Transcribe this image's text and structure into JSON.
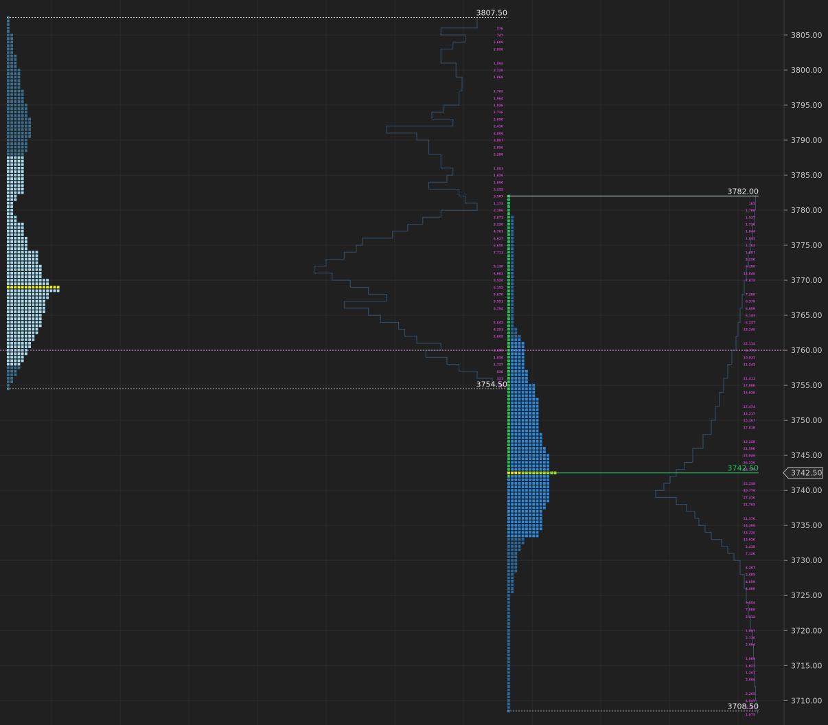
{
  "chart_data": {
    "type": "market-profile",
    "y_axis": {
      "min": 3706.5,
      "max": 3810.0,
      "ticks": [
        "3710.00",
        "3715.00",
        "3720.00",
        "3725.00",
        "3730.00",
        "3735.00",
        "3740.00",
        "3745.00",
        "3750.00",
        "3755.00",
        "3760.00",
        "3765.00",
        "3770.00",
        "3775.00",
        "3780.00",
        "3785.00",
        "3790.00",
        "3795.00",
        "3800.00",
        "3805.00"
      ],
      "tick_step": 5,
      "side": "right",
      "current_price": "3742.50",
      "grid": true
    },
    "profiles": [
      {
        "name": "prior-session",
        "high": 3807.5,
        "low": 3754.5,
        "high_label": "3807.50",
        "low_label": "3754.50",
        "poc": 3769.0,
        "tpo_tick": 0.5,
        "value_area": [
          3758.0,
          3787.5
        ],
        "colors": {
          "outside_va": "#3a6f90",
          "inside_va": "#a8dcf0",
          "poc": "#f2f21a"
        },
        "tpo_counts": [
          [
            3807.5,
            1
          ],
          [
            3805,
            2
          ],
          [
            3802,
            3
          ],
          [
            3800,
            4
          ],
          [
            3797,
            5
          ],
          [
            3795,
            6
          ],
          [
            3793,
            7
          ],
          [
            3790,
            6
          ],
          [
            3788,
            5
          ],
          [
            3786,
            5
          ],
          [
            3784,
            5
          ],
          [
            3782,
            3
          ],
          [
            3781,
            2
          ],
          [
            3780,
            2
          ],
          [
            3779,
            3
          ],
          [
            3778,
            5
          ],
          [
            3776,
            6
          ],
          [
            3774,
            9
          ],
          [
            3772,
            10
          ],
          [
            3770,
            12
          ],
          [
            3769,
            15
          ],
          [
            3768,
            12
          ],
          [
            3767,
            11
          ],
          [
            3765,
            10
          ],
          [
            3763,
            9
          ],
          [
            3762,
            8
          ],
          [
            3761,
            7
          ],
          [
            3760,
            6
          ],
          [
            3759,
            5
          ],
          [
            3758,
            4
          ],
          [
            3757,
            3
          ],
          [
            3756,
            2
          ],
          [
            3755,
            1
          ],
          [
            3754.5,
            1
          ]
        ],
        "volume_outline": [
          [
            3807.5,
            0.1
          ],
          [
            3806,
            0.22
          ],
          [
            3805,
            0.14
          ],
          [
            3804,
            0.18
          ],
          [
            3803,
            0.22
          ],
          [
            3801,
            0.17
          ],
          [
            3799,
            0.15
          ],
          [
            3797,
            0.16
          ],
          [
            3795,
            0.21
          ],
          [
            3794,
            0.25
          ],
          [
            3793,
            0.18
          ],
          [
            3792,
            0.4
          ],
          [
            3791,
            0.3
          ],
          [
            3790,
            0.26
          ],
          [
            3788,
            0.22
          ],
          [
            3786,
            0.18
          ],
          [
            3785,
            0.2
          ],
          [
            3784,
            0.26
          ],
          [
            3783,
            0.16
          ],
          [
            3782,
            0.14
          ],
          [
            3781,
            0.1
          ],
          [
            3780,
            0.22
          ],
          [
            3779,
            0.28
          ],
          [
            3778,
            0.33
          ],
          [
            3777,
            0.38
          ],
          [
            3776,
            0.48
          ],
          [
            3775,
            0.5
          ],
          [
            3774,
            0.54
          ],
          [
            3773,
            0.6
          ],
          [
            3772,
            0.64
          ],
          [
            3771,
            0.58
          ],
          [
            3770,
            0.52
          ],
          [
            3769,
            0.46
          ],
          [
            3768,
            0.4
          ],
          [
            3767,
            0.54
          ],
          [
            3766,
            0.46
          ],
          [
            3765,
            0.42
          ],
          [
            3764,
            0.36
          ],
          [
            3763,
            0.34
          ],
          [
            3762,
            0.3
          ],
          [
            3761,
            0.22
          ],
          [
            3760,
            0.27
          ],
          [
            3759,
            0.2
          ],
          [
            3758,
            0.16
          ],
          [
            3757,
            0.1
          ],
          [
            3756,
            0.05
          ],
          [
            3755,
            0.02
          ]
        ],
        "volume_labels": [
          [
            3806,
            "576"
          ],
          [
            3805,
            "747"
          ],
          [
            3804,
            "1,609"
          ],
          [
            3803,
            "2,026"
          ],
          [
            3801,
            "1,092"
          ],
          [
            3800,
            "2,128"
          ],
          [
            3799,
            "1,869"
          ],
          [
            3797,
            "1,762"
          ],
          [
            3796,
            "1,964"
          ],
          [
            3795,
            "1,826"
          ],
          [
            3794,
            "1,726"
          ],
          [
            3793,
            "2,050"
          ],
          [
            3792,
            "2,410"
          ],
          [
            3791,
            "4,009"
          ],
          [
            3790,
            "3,887"
          ],
          [
            3789,
            "2,850"
          ],
          [
            3788,
            "2,299"
          ],
          [
            3786,
            "1,081"
          ],
          [
            3785,
            "1,626"
          ],
          [
            3784,
            "1,890"
          ],
          [
            3783,
            "2,222"
          ],
          [
            3782,
            "3,507"
          ],
          [
            3781,
            "1,173"
          ],
          [
            3780,
            "2,186"
          ],
          [
            3779,
            "3,871"
          ],
          [
            3778,
            "3,230"
          ],
          [
            3777,
            "4,761"
          ],
          [
            3776,
            "6,627"
          ],
          [
            3775,
            "6,650"
          ],
          [
            3774,
            "7,711"
          ],
          [
            3772,
            "5,130"
          ],
          [
            3771,
            "6,603"
          ],
          [
            3770,
            "5,520"
          ],
          [
            3769,
            "6,152"
          ],
          [
            3768,
            "5,670"
          ],
          [
            3767,
            "5,551"
          ],
          [
            3766,
            "3,794"
          ],
          [
            3764,
            "5,643"
          ],
          [
            3763,
            "4,251"
          ],
          [
            3762,
            "2,662"
          ],
          [
            3760,
            "2,699"
          ],
          [
            3759,
            "1,839"
          ],
          [
            3758,
            "1,727"
          ],
          [
            3757,
            "836"
          ],
          [
            3756,
            "321"
          ],
          [
            3755,
            "39"
          ]
        ]
      },
      {
        "name": "current-session",
        "high": 3782.0,
        "low": 3708.5,
        "high_label": "3782.00",
        "low_label": "3708.50",
        "poc": 3742.5,
        "poc_label": "3742.50",
        "tpo_tick": 0.5,
        "initial_balance": [
          3742.0,
          3782.0
        ],
        "value_area": [
          3733.5,
          3761.5
        ],
        "colors": {
          "outside_va": "#2a6aa0",
          "inside_va": "#2a8ae0",
          "initial_balance": "#21c75a",
          "poc": "#f2f21a"
        },
        "tpo_counts": [
          [
            3782,
            1
          ],
          [
            3779,
            2
          ],
          [
            3765,
            2
          ],
          [
            3763,
            3
          ],
          [
            3762,
            4
          ],
          [
            3761,
            5
          ],
          [
            3759,
            5
          ],
          [
            3757,
            6
          ],
          [
            3755,
            8
          ],
          [
            3753,
            9
          ],
          [
            3750,
            9
          ],
          [
            3748,
            10
          ],
          [
            3746,
            11
          ],
          [
            3745,
            12
          ],
          [
            3743,
            12
          ],
          [
            3742.5,
            14
          ],
          [
            3742,
            12
          ],
          [
            3740,
            12
          ],
          [
            3738,
            11
          ],
          [
            3737,
            10
          ],
          [
            3735,
            10
          ],
          [
            3734,
            9
          ],
          [
            3733,
            5
          ],
          [
            3732,
            4
          ],
          [
            3731,
            3
          ],
          [
            3730,
            3
          ],
          [
            3728,
            2
          ],
          [
            3726,
            2
          ],
          [
            3725,
            1
          ],
          [
            3720,
            1
          ],
          [
            3709,
            1
          ],
          [
            3708.5,
            1
          ]
        ],
        "volume_outline": [
          [
            3782,
            0.03
          ],
          [
            3780,
            0.04
          ],
          [
            3778,
            0.06
          ],
          [
            3776,
            0.08
          ],
          [
            3774,
            0.1
          ],
          [
            3772,
            0.12
          ],
          [
            3770,
            0.14
          ],
          [
            3768,
            0.16
          ],
          [
            3766,
            0.18
          ],
          [
            3764,
            0.2
          ],
          [
            3762,
            0.22
          ],
          [
            3760,
            0.26
          ],
          [
            3758,
            0.3
          ],
          [
            3756,
            0.34
          ],
          [
            3754,
            0.38
          ],
          [
            3752,
            0.42
          ],
          [
            3750,
            0.46
          ],
          [
            3748,
            0.54
          ],
          [
            3746,
            0.64
          ],
          [
            3744,
            0.72
          ],
          [
            3743,
            0.8
          ],
          [
            3742,
            0.86
          ],
          [
            3741,
            0.92
          ],
          [
            3740,
            1.0
          ],
          [
            3739,
            0.8
          ],
          [
            3738,
            0.7
          ],
          [
            3737,
            0.62
          ],
          [
            3736,
            0.58
          ],
          [
            3735,
            0.52
          ],
          [
            3734,
            0.46
          ],
          [
            3733,
            0.36
          ],
          [
            3732,
            0.3
          ],
          [
            3731,
            0.24
          ],
          [
            3730,
            0.18
          ],
          [
            3728,
            0.14
          ],
          [
            3726,
            0.12
          ],
          [
            3724,
            0.1
          ],
          [
            3722,
            0.08
          ],
          [
            3720,
            0.06
          ],
          [
            3718,
            0.05
          ],
          [
            3716,
            0.04
          ],
          [
            3714,
            0.04
          ],
          [
            3712,
            0.03
          ],
          [
            3710,
            0.02
          ],
          [
            3708.5,
            0.01
          ]
        ],
        "volume_labels": [
          [
            3781,
            "165"
          ],
          [
            3780,
            "1,788"
          ],
          [
            3779,
            "1,537"
          ],
          [
            3778,
            "1,736"
          ],
          [
            3777,
            "1,844"
          ],
          [
            3776,
            "1,043"
          ],
          [
            3775,
            "1,762"
          ],
          [
            3774,
            "1,697"
          ],
          [
            3773,
            "3,230"
          ],
          [
            3772,
            "6,286"
          ],
          [
            3771,
            "13,046"
          ],
          [
            3770,
            "7,873"
          ],
          [
            3768,
            "7,288"
          ],
          [
            3767,
            "6,379"
          ],
          [
            3766,
            "6,609"
          ],
          [
            3765,
            "6,143"
          ],
          [
            3764,
            "6,237"
          ],
          [
            3763,
            "13,246"
          ],
          [
            3761,
            "22,114"
          ],
          [
            3760,
            "3,771"
          ],
          [
            3759,
            "10,032"
          ],
          [
            3758,
            "11,243"
          ],
          [
            3756,
            "11,411"
          ],
          [
            3755,
            "17,880"
          ],
          [
            3754,
            "14,038"
          ],
          [
            3752,
            "17,474"
          ],
          [
            3751,
            "13,217"
          ],
          [
            3750,
            "15,467"
          ],
          [
            3749,
            "17,618"
          ],
          [
            3747,
            "15,258"
          ],
          [
            3746,
            "21,590"
          ],
          [
            3745,
            "22,846"
          ],
          [
            3744,
            "26,226"
          ],
          [
            3743,
            "34,778"
          ],
          [
            3741,
            "25,238"
          ],
          [
            3740,
            "40,779"
          ],
          [
            3739,
            "27,410"
          ],
          [
            3738,
            "21,765"
          ],
          [
            3736,
            "21,370"
          ],
          [
            3735,
            "24,306"
          ],
          [
            3734,
            "13,226"
          ],
          [
            3733,
            "13,020"
          ],
          [
            3732,
            "3,418"
          ],
          [
            3731,
            "7,120"
          ],
          [
            3729,
            "4,207"
          ],
          [
            3728,
            "2,605"
          ],
          [
            3727,
            "4,659"
          ],
          [
            3726,
            "4,008"
          ],
          [
            3724,
            "5,904"
          ],
          [
            3723,
            "7,808"
          ],
          [
            3722,
            "2,212"
          ],
          [
            3720,
            "1,097"
          ],
          [
            3719,
            "2,116"
          ],
          [
            3718,
            "2,094"
          ],
          [
            3716,
            "1,009"
          ],
          [
            3715,
            "1,027"
          ],
          [
            3714,
            "1,207"
          ],
          [
            3713,
            "2,809"
          ],
          [
            3711,
            "5,265"
          ],
          [
            3710,
            "4,045"
          ],
          [
            3709,
            "2,207"
          ],
          [
            3708,
            "1,973"
          ]
        ]
      }
    ],
    "reference_lines": [
      {
        "name": "prior-high",
        "price": 3807.5,
        "style": "dotted",
        "color": "#cfcfcf",
        "label": "3807.50"
      },
      {
        "name": "prior-low",
        "price": 3754.5,
        "style": "dotted",
        "color": "#cfcfcf",
        "label": "3754.50"
      },
      {
        "name": "prior-mid",
        "price": 3760.0,
        "style": "dotted",
        "color": "#d08ad0",
        "label": ""
      },
      {
        "name": "session-high",
        "price": 3782.0,
        "style": "solid",
        "color": "#d8e8e8",
        "label": "3782.00"
      },
      {
        "name": "session-poc",
        "price": 3742.5,
        "style": "solid",
        "color": "#21c75a",
        "label": "3742.50"
      },
      {
        "name": "session-low",
        "price": 3708.5,
        "style": "dotted",
        "color": "#cfcfcf",
        "label": "3708.50"
      }
    ]
  }
}
